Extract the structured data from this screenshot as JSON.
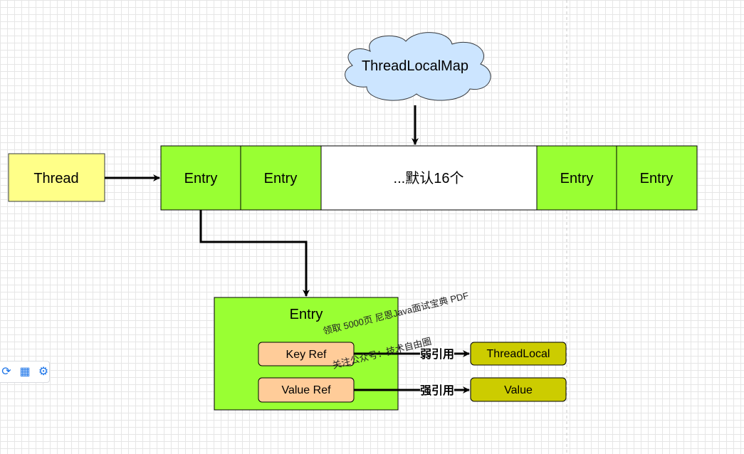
{
  "diagram": {
    "cloud_label": "ThreadLocalMap",
    "thread_label": "Thread",
    "entries": [
      "Entry",
      "Entry",
      "...默认16个",
      "Entry",
      "Entry"
    ],
    "entry_detail": {
      "title": "Entry",
      "key_ref": "Key Ref",
      "value_ref": "Value Ref"
    },
    "weak_ref_label": "弱引用",
    "strong_ref_label": "强引用",
    "threadlocal_label": "ThreadLocal",
    "value_label": "Value",
    "watermark_1": "领取 5000页 尼恩Java面试宝典 PDF",
    "watermark_2": "关注公众号：技术自由圈"
  },
  "colors": {
    "green": "#99ff33",
    "yellow": "#ffff88",
    "cloud": "#cce5ff",
    "orange": "#ffcc99",
    "olive": "#cccc00"
  },
  "toolbar": {
    "icons": [
      "refresh-icon",
      "apps-icon",
      "settings-icon"
    ]
  }
}
